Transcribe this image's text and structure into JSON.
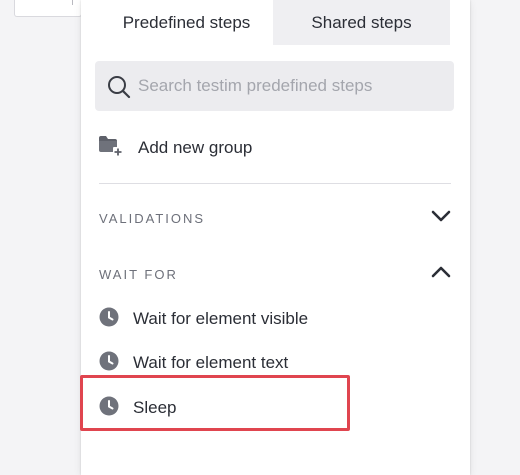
{
  "tabs": {
    "predefined_label": "Predefined steps",
    "shared_label": "Shared steps",
    "active": "predefined"
  },
  "search": {
    "placeholder": "Search testim predefined steps",
    "value": "",
    "icon": "search-icon"
  },
  "add_group": {
    "label": "Add new group",
    "icon": "folder-add-icon"
  },
  "sections": {
    "validations": {
      "title": "VALIDATIONS",
      "state": "collapsed",
      "icon": "chevron-down-icon"
    },
    "wait_for": {
      "title": "WAIT FOR",
      "state": "expanded",
      "icon": "chevron-up-icon",
      "items": [
        {
          "label": "Wait for element visible",
          "icon": "clock-icon"
        },
        {
          "label": "Wait for element text",
          "icon": "clock-icon"
        },
        {
          "label": "Sleep",
          "icon": "clock-icon",
          "highlighted": true
        }
      ]
    }
  },
  "colors": {
    "highlight_border": "#e0454f",
    "icon_gray": "#6f727b",
    "text": "#2b2e36",
    "tab_bar": "#efeff2"
  }
}
